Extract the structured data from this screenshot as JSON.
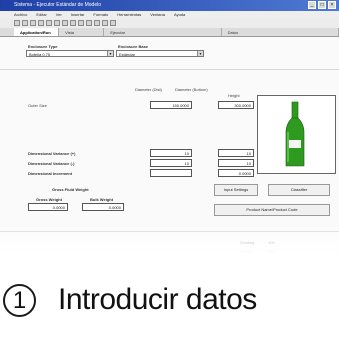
{
  "window": {
    "title": "Sistema - Ejecutor Estándar de Modelo",
    "controls": [
      "_",
      "□",
      "×"
    ]
  },
  "menu": [
    "Archivo",
    "Editar",
    "Ver",
    "Insertar",
    "Formato",
    "Herramientas",
    "Ventana",
    "Ayuda"
  ],
  "toolbar_icons": [
    "new-icon",
    "open-icon",
    "save-icon",
    "print-icon",
    "cut-icon",
    "copy-icon",
    "paste-icon",
    "undo-icon",
    "redo-icon",
    "help-icon",
    "zoom-icon",
    "settings-icon",
    "refresh-icon"
  ],
  "tabs": [
    "Application/Run",
    "Vista",
    "Ejecutar",
    "Datos"
  ],
  "form": {
    "enclosing_label": "Enclosure Type",
    "enclosing_value": "Botella 0,75",
    "base_label": "Enclosure Base",
    "base_value": "Estándar",
    "diameter_head": "Diameter (Dist)",
    "diameter_head2": "Diameter (Bottom)",
    "height_head": "Height",
    "size_label": "Outer Size",
    "diameter_value": "150.0000",
    "height_value": "300.0000",
    "tol1_label": "Dimensional Variance (+)",
    "tol1_value": "10",
    "tol1_value2": "10",
    "tol2_label": "Dimensional Variance (-)",
    "tol2_value": "10",
    "tol2_value2": "10",
    "inc_label": "Dimensional Increment",
    "inc_value": "0.0000",
    "weight_title": "Gross Fluid Weight",
    "gross_label": "Gross Weight",
    "gross_value": "0.0000",
    "bulk_label": "Bulk Weight",
    "bulk_value": "0.0000",
    "input_settings": "Input Settings",
    "classifier": "Classifier",
    "product_btn": "Product Name/Product Code",
    "status_1": "Grading",
    "status_2": "Result",
    "status_3": "100",
    "status_4": "250"
  },
  "caption": {
    "number": "1",
    "text": "Introducir datos"
  },
  "colors": {
    "titlebar": "#1f3fa6",
    "bottle": "#2e9a1f"
  }
}
